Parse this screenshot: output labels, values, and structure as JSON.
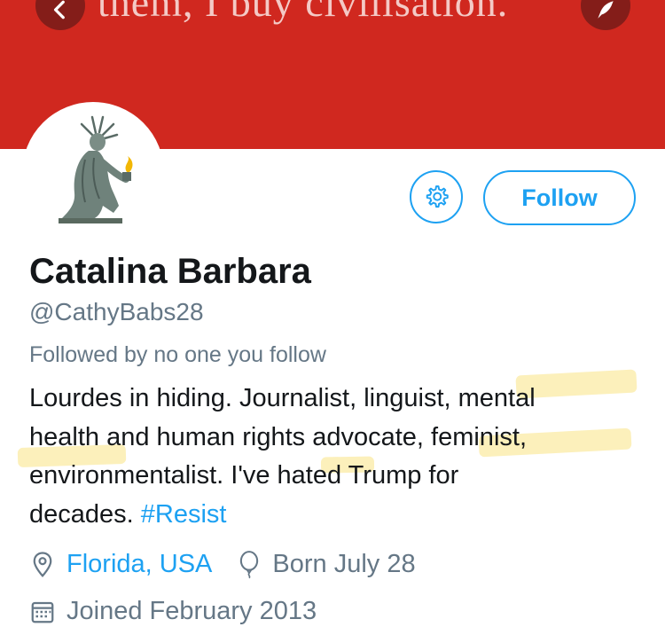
{
  "header": {
    "banner_text": "them, I buy civilisation."
  },
  "icons": {
    "back": "chevron-left-icon",
    "compose": "quill-icon",
    "settings": "gear-icon",
    "location": "location-pin-icon",
    "birthday": "balloon-icon",
    "joined": "calendar-icon"
  },
  "actions": {
    "follow_label": "Follow"
  },
  "profile": {
    "name": "Catalina Barbara",
    "handle": "@CathyBabs28",
    "followed_by": "Followed by no one you follow",
    "bio_line1": "Lourdes in hiding. Journalist, linguist, mental",
    "bio_line2": "health and human rights advocate, feminist,",
    "bio_line3": "environmentalist. I've hated Trump for",
    "bio_line4_text": "decades. ",
    "bio_hashtag": "#Resist",
    "location": "Florida, USA",
    "birthday": "Born July 28",
    "joined": "Joined February 2013"
  },
  "colors": {
    "header_bg": "#d0281f",
    "accent": "#1da1f2",
    "secondary_text": "#657786",
    "highlighter": "#fae278"
  }
}
